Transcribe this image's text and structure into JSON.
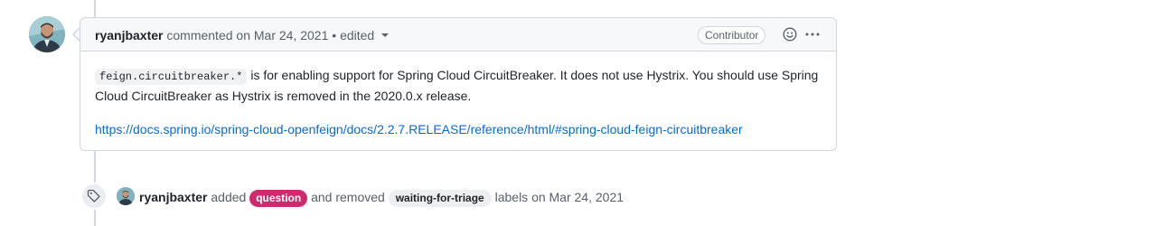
{
  "comment": {
    "author": "ryanjbaxter",
    "action": "commented on",
    "date": "Mar 24, 2021",
    "separator": "•",
    "edited": "edited",
    "role_badge": "Contributor",
    "body": {
      "code": "feign.circuitbreaker.*",
      "paragraph_rest": "is for enabling support for Spring Cloud CircuitBreaker. It does not use Hystrix. You should use Spring Cloud CircuitBreaker as Hystrix is removed in the 2020.0.x release.",
      "link": "https://docs.spring.io/spring-cloud-openfeign/docs/2.2.7.RELEASE/reference/html/#spring-cloud-feign-circuitbreaker"
    },
    "icons": [
      "smiley-icon",
      "kebab-icon",
      "chevron-down-icon"
    ]
  },
  "event": {
    "icon": "tag-icon",
    "author": "ryanjbaxter",
    "added_text": "added",
    "added_label": "question",
    "removed_text": "and removed",
    "removed_label": "waiting-for-triage",
    "suffix": "labels on Mar 24, 2021"
  },
  "colors": {
    "question_label": "#d1296d",
    "triage_label": "#edeff2",
    "link": "#0969da"
  }
}
